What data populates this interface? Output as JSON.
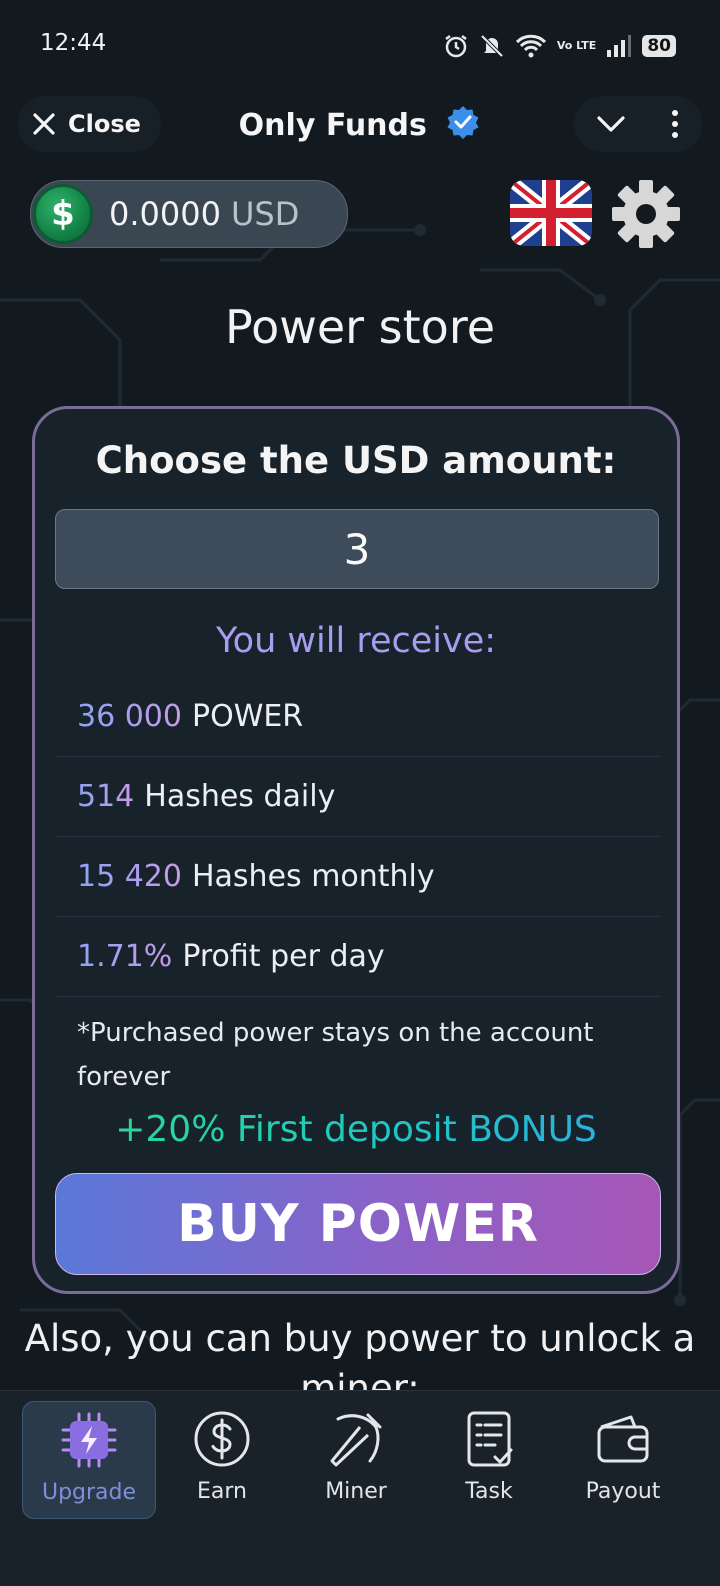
{
  "status_bar": {
    "time": "12:44",
    "battery": "80",
    "network": "Vo LTE"
  },
  "header": {
    "close_label": "Close",
    "title": "Only Funds"
  },
  "balance": {
    "value": "0.0000",
    "currency": "USD"
  },
  "page_title": "Power store",
  "store": {
    "heading": "Choose the USD amount:",
    "amount_value": "3",
    "receive_label": "You will receive:",
    "rows": [
      {
        "num": "36 000",
        "label": "POWER"
      },
      {
        "num": "514",
        "label": "Hashes daily"
      },
      {
        "num": "15 420",
        "label": "Hashes monthly"
      },
      {
        "num": "1.71%",
        "label": "Profit per day"
      }
    ],
    "note": "*Purchased power stays on the account forever",
    "bonus": "+20% First deposit BONUS",
    "buy_label": "BUY POWER"
  },
  "also_text": "Also, you can buy power to unlock a miner:",
  "nav": [
    {
      "label": "Upgrade",
      "icon": "chip-bolt-icon",
      "active": true
    },
    {
      "label": "Earn",
      "icon": "dollar-circle-icon",
      "active": false
    },
    {
      "label": "Miner",
      "icon": "pickaxe-icon",
      "active": false
    },
    {
      "label": "Task",
      "icon": "clipboard-check-icon",
      "active": false
    },
    {
      "label": "Payout",
      "icon": "wallet-icon",
      "active": false
    }
  ],
  "colors": {
    "background": "#121a20",
    "card_border": "#7a6c99",
    "accent_purple": "#a89cf0",
    "bonus_green": "#2ddc8c",
    "bonus_blue": "#2ea8e6",
    "button_start": "#5a78d8",
    "button_end": "#a656b6",
    "coin_green": "#1f9a55"
  }
}
